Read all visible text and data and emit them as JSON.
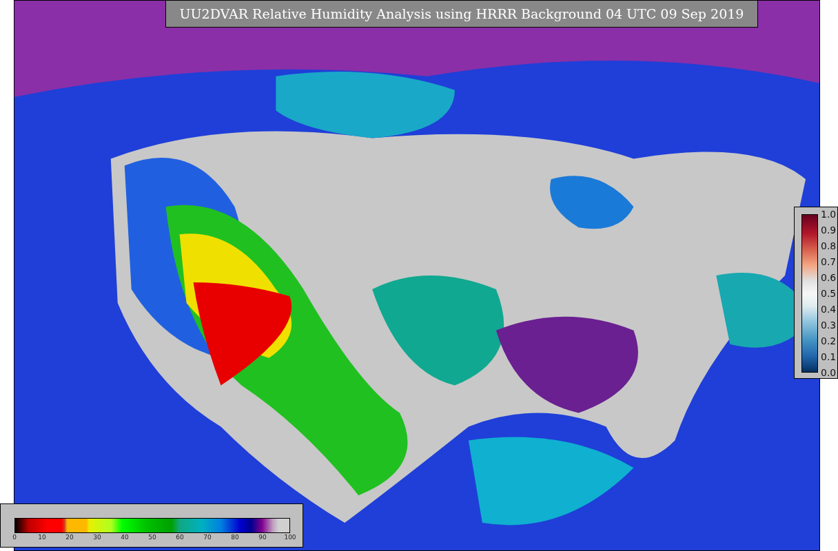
{
  "title": "UU2DVAR Relative Humidity Analysis using HRRR Background 04 UTC 09 Sep 2019",
  "humidity_colorbar": {
    "ticks": [
      "0",
      "10",
      "20",
      "30",
      "40",
      "50",
      "60",
      "70",
      "80",
      "90",
      "100"
    ]
  },
  "ratio_colorbar": {
    "ticks": [
      "1.0",
      "0.9",
      "0.8",
      "0.7",
      "0.6",
      "0.5",
      "0.4",
      "0.3",
      "0.2",
      "0.1",
      "0.0"
    ]
  }
}
